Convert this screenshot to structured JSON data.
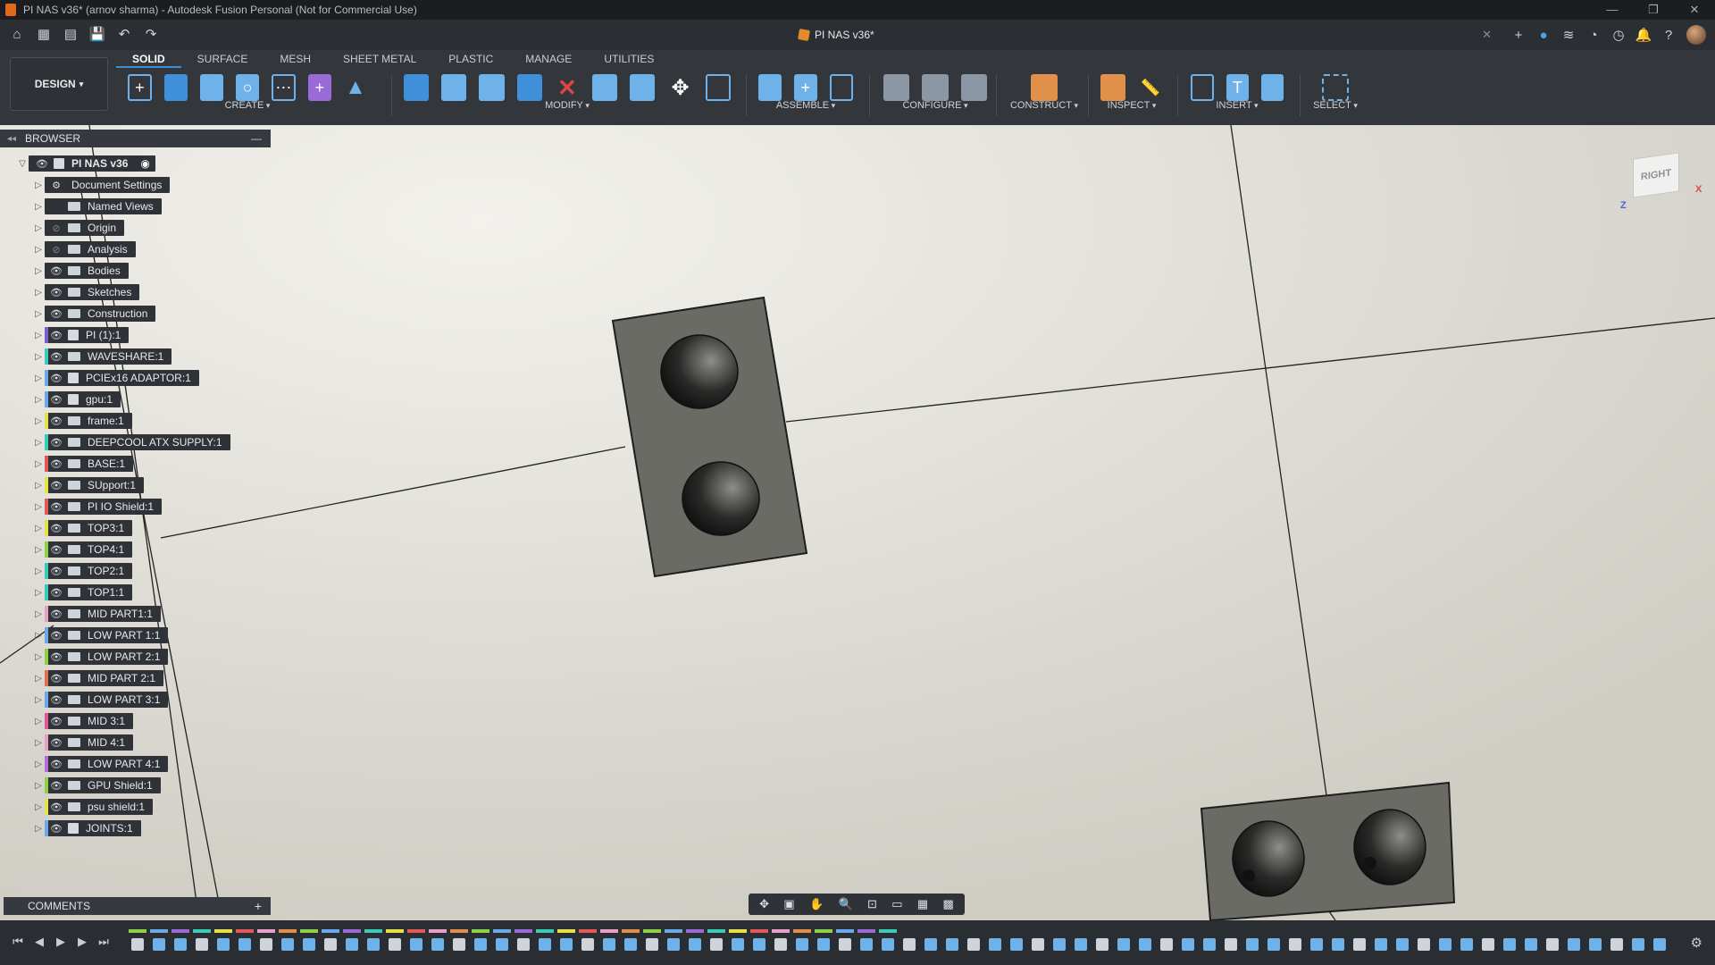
{
  "window": {
    "title": "PI NAS v36* (arnov sharma) - Autodesk Fusion Personal (Not for Commercial Use)",
    "controls": [
      "—",
      "❐",
      "✕"
    ]
  },
  "quick_access": {
    "icons": [
      "home-icon",
      "grid-icon",
      "file-icon",
      "save-icon",
      "undo-icon",
      "redo-icon"
    ]
  },
  "document_tab": {
    "label": "PI NAS v36*",
    "close": "✕"
  },
  "top_right_icons": [
    "plus-icon",
    "help-circle-icon",
    "extensions-icon",
    "online-icon",
    "clock-icon",
    "bell-icon",
    "question-icon",
    "avatar"
  ],
  "workspace": {
    "label": "DESIGN"
  },
  "ribbon": {
    "tabs": [
      {
        "label": "SOLID",
        "active": true
      },
      {
        "label": "SURFACE",
        "active": false
      },
      {
        "label": "MESH",
        "active": false
      },
      {
        "label": "SHEET METAL",
        "active": false
      },
      {
        "label": "PLASTIC",
        "active": false
      },
      {
        "label": "MANAGE",
        "active": false
      },
      {
        "label": "UTILITIES",
        "active": false
      }
    ],
    "groups": {
      "create": "CREATE",
      "modify": "MODIFY",
      "assemble": "ASSEMBLE",
      "configure": "CONFIGURE",
      "construct": "CONSTRUCT",
      "inspect": "INSPECT",
      "insert": "INSERT",
      "select": "SELECT"
    }
  },
  "browser": {
    "header": "BROWSER",
    "root": "PI NAS v36",
    "items": [
      {
        "label": "Document Settings",
        "type": "settings",
        "eye": "none",
        "color": ""
      },
      {
        "label": "Named Views",
        "type": "folder",
        "eye": "none",
        "color": ""
      },
      {
        "label": "Origin",
        "type": "folder",
        "eye": "hidden",
        "color": ""
      },
      {
        "label": "Analysis",
        "type": "folder",
        "eye": "hidden",
        "color": ""
      },
      {
        "label": "Bodies",
        "type": "folder",
        "eye": "visible",
        "color": ""
      },
      {
        "label": "Sketches",
        "type": "folder",
        "eye": "visible",
        "color": ""
      },
      {
        "label": "Construction",
        "type": "folder",
        "eye": "visible",
        "color": ""
      },
      {
        "label": "PI (1):1",
        "type": "component",
        "eye": "visible",
        "color": "#7a5fd0"
      },
      {
        "label": "WAVESHARE:1",
        "type": "body",
        "eye": "visible",
        "color": "#3ec8b8"
      },
      {
        "label": "PCIEx16 ADAPTOR:1",
        "type": "component",
        "eye": "visible",
        "color": "#6aa8e8"
      },
      {
        "label": "gpu:1",
        "type": "component",
        "eye": "visible",
        "color": "#6aa8e8"
      },
      {
        "label": "frame:1",
        "type": "body",
        "eye": "visible",
        "color": "#e6e04a"
      },
      {
        "label": "DEEPCOOL ATX SUPPLY:1",
        "type": "body",
        "eye": "visible",
        "color": "#3ec8b8"
      },
      {
        "label": "BASE:1",
        "type": "body",
        "eye": "visible",
        "color": "#e05858"
      },
      {
        "label": "SUpport:1",
        "type": "body",
        "eye": "visible",
        "color": "#e6e04a"
      },
      {
        "label": "PI IO Shield:1",
        "type": "body",
        "eye": "visible",
        "color": "#e05858"
      },
      {
        "label": "TOP3:1",
        "type": "body",
        "eye": "visible",
        "color": "#e6e04a"
      },
      {
        "label": "TOP4:1",
        "type": "body",
        "eye": "visible",
        "color": "#8fd04a"
      },
      {
        "label": "TOP2:1",
        "type": "body",
        "eye": "visible",
        "color": "#3ec8b8"
      },
      {
        "label": "TOP1:1",
        "type": "body",
        "eye": "visible",
        "color": "#3ec8b8"
      },
      {
        "label": "MID PART1:1",
        "type": "body",
        "eye": "visible",
        "color": "#e6a0c8"
      },
      {
        "label": "LOW PART 1:1",
        "type": "body",
        "eye": "visible",
        "color": "#6aa8e8"
      },
      {
        "label": "LOW PART 2:1",
        "type": "body",
        "eye": "visible",
        "color": "#8fd04a"
      },
      {
        "label": "MID PART 2:1",
        "type": "body",
        "eye": "visible",
        "color": "#e07050"
      },
      {
        "label": "LOW PART 3:1",
        "type": "body",
        "eye": "visible",
        "color": "#6aa8e8"
      },
      {
        "label": "MID 3:1",
        "type": "body",
        "eye": "visible",
        "color": "#e05898"
      },
      {
        "label": "MID 4:1",
        "type": "body",
        "eye": "visible",
        "color": "#e6a0c8"
      },
      {
        "label": "LOW PART 4:1",
        "type": "body",
        "eye": "visible",
        "color": "#b070d8"
      },
      {
        "label": "GPU Shield:1",
        "type": "body",
        "eye": "visible",
        "color": "#8fd04a"
      },
      {
        "label": "psu shield:1",
        "type": "body",
        "eye": "visible",
        "color": "#e6e04a"
      },
      {
        "label": "JOINTS:1",
        "type": "component",
        "eye": "visible",
        "color": "#6aa8e8"
      }
    ]
  },
  "comments": {
    "label": "COMMENTS",
    "add": "+"
  },
  "viewcube": {
    "face": "RIGHT",
    "axis_z": "Z",
    "axis_x": "X"
  },
  "navbar": {
    "icons": [
      "orbit-icon",
      "look-at-icon",
      "pan-icon",
      "zoom-icon",
      "fit-icon",
      "display-settings-icon",
      "grid-icon",
      "viewports-icon"
    ]
  },
  "timeline": {
    "controls": [
      "⏮",
      "◀",
      "▶",
      "▶",
      "⏭"
    ]
  }
}
